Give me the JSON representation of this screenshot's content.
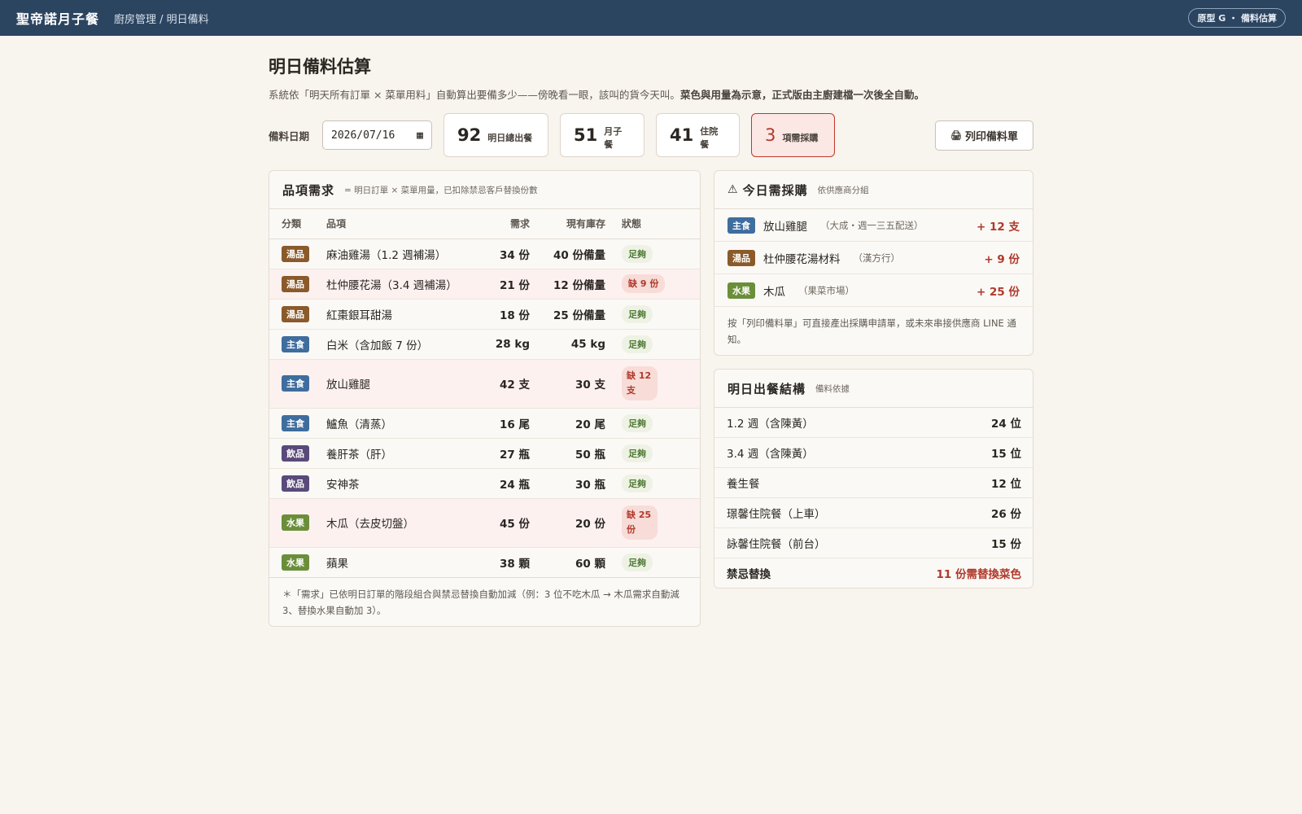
{
  "colors": {
    "topbar": "#2b4460",
    "soup": "#8b5a2b",
    "staple": "#3f6d9e",
    "drink": "#5a4a7a",
    "fruit": "#6b8e3a",
    "alert": "#b0392b",
    "ok": "#4f7a35"
  },
  "header": {
    "brand": "聖帝諾月子餐",
    "breadcrumb": "廚房管理 / 明日備料",
    "version_pill": "原型 G ・ 備料估算"
  },
  "page": {
    "title": "明日備料估算",
    "desc_plain": "系統依「明天所有訂單 × 菜單用料」自動算出要備多少——傍晚看一眼，該叫的貨今天叫。",
    "desc_bold": "菜色與用量為示意，正式版由主廚建檔一次後全自動。"
  },
  "controls": {
    "date_label": "備料日期",
    "date_value": "2026/07/16",
    "print_label": "列印備料單"
  },
  "stats": [
    {
      "num": "92",
      "label": "明日總出餐"
    },
    {
      "num": "51",
      "label": "月子餐"
    },
    {
      "num": "41",
      "label": "住院餐"
    },
    {
      "num": "3",
      "label": "項需採購"
    }
  ],
  "items_table": {
    "title": "品項需求",
    "subtitle": "= 明日訂單 × 菜單用量，已扣除禁忌客戶替換份數",
    "headers": {
      "category": "分類",
      "item": "品項",
      "need": "需求",
      "stock": "現有庫存",
      "status": "狀態"
    },
    "rows": [
      {
        "cat": "湯品",
        "name": "麻油雞湯（1.2 週補湯）",
        "need": "34 份",
        "stock": "40 份備量",
        "status": "足夠"
      },
      {
        "cat": "湯品",
        "name": "杜仲腰花湯（3.4 週補湯）",
        "need": "21 份",
        "stock": "12 份備量",
        "status": "缺 9 份"
      },
      {
        "cat": "湯品",
        "name": "紅棗銀耳甜湯",
        "need": "18 份",
        "stock": "25 份備量",
        "status": "足夠"
      },
      {
        "cat": "主食",
        "name": "白米（含加飯 7 份）",
        "need": "28 kg",
        "stock": "45 kg",
        "status": "足夠"
      },
      {
        "cat": "主食",
        "name": "放山雞腿",
        "need": "42 支",
        "stock": "30 支",
        "status": "缺 12 支"
      },
      {
        "cat": "主食",
        "name": "鱸魚（清蒸）",
        "need": "16 尾",
        "stock": "20 尾",
        "status": "足夠"
      },
      {
        "cat": "飲品",
        "name": "養肝茶（肝）",
        "need": "27 瓶",
        "stock": "50 瓶",
        "status": "足夠"
      },
      {
        "cat": "飲品",
        "name": "安神茶",
        "need": "24 瓶",
        "stock": "30 瓶",
        "status": "足夠"
      },
      {
        "cat": "水果",
        "name": "木瓜（去皮切盤）",
        "need": "45 份",
        "stock": "20 份",
        "status": "缺 25 份"
      },
      {
        "cat": "水果",
        "name": "蘋果",
        "need": "38 顆",
        "stock": "60 顆",
        "status": "足夠"
      }
    ],
    "footnote": "＊「需求」已依明日訂單的階段組合與禁忌替換自動加減（例：3 位不吃木瓜 → 木瓜需求自動減 3、替換水果自動加 3）。"
  },
  "purchase": {
    "title": "今日需採購",
    "subtitle": "依供應商分組",
    "rows": [
      {
        "cat": "主食",
        "name": "放山雞腿",
        "supplier": "（大成・週一三五配送）",
        "amount": "+ 12 支"
      },
      {
        "cat": "湯品",
        "name": "杜仲腰花湯材料",
        "supplier": "（漢方行）",
        "amount": "+ 9 份"
      },
      {
        "cat": "水果",
        "name": "木瓜",
        "supplier": "（果菜市場）",
        "amount": "+ 25 份"
      }
    ],
    "note": "按「列印備料單」可直接產出採購申請單，或未來串接供應商 LINE 通知。"
  },
  "meal_mix": {
    "title": "明日出餐結構",
    "subtitle": "備料依據",
    "rows": [
      {
        "label": "1.2 週（含陳黃）",
        "value": "24 位"
      },
      {
        "label": "3.4 週（含陳黃）",
        "value": "15 位"
      },
      {
        "label": "養生餐",
        "value": "12 位"
      },
      {
        "label": "璟馨住院餐（上車）",
        "value": "26 份"
      },
      {
        "label": "詠馨住院餐（前台）",
        "value": "15 份"
      }
    ],
    "summary_label": "禁忌替換",
    "summary_value": "11 份需替換菜色"
  }
}
